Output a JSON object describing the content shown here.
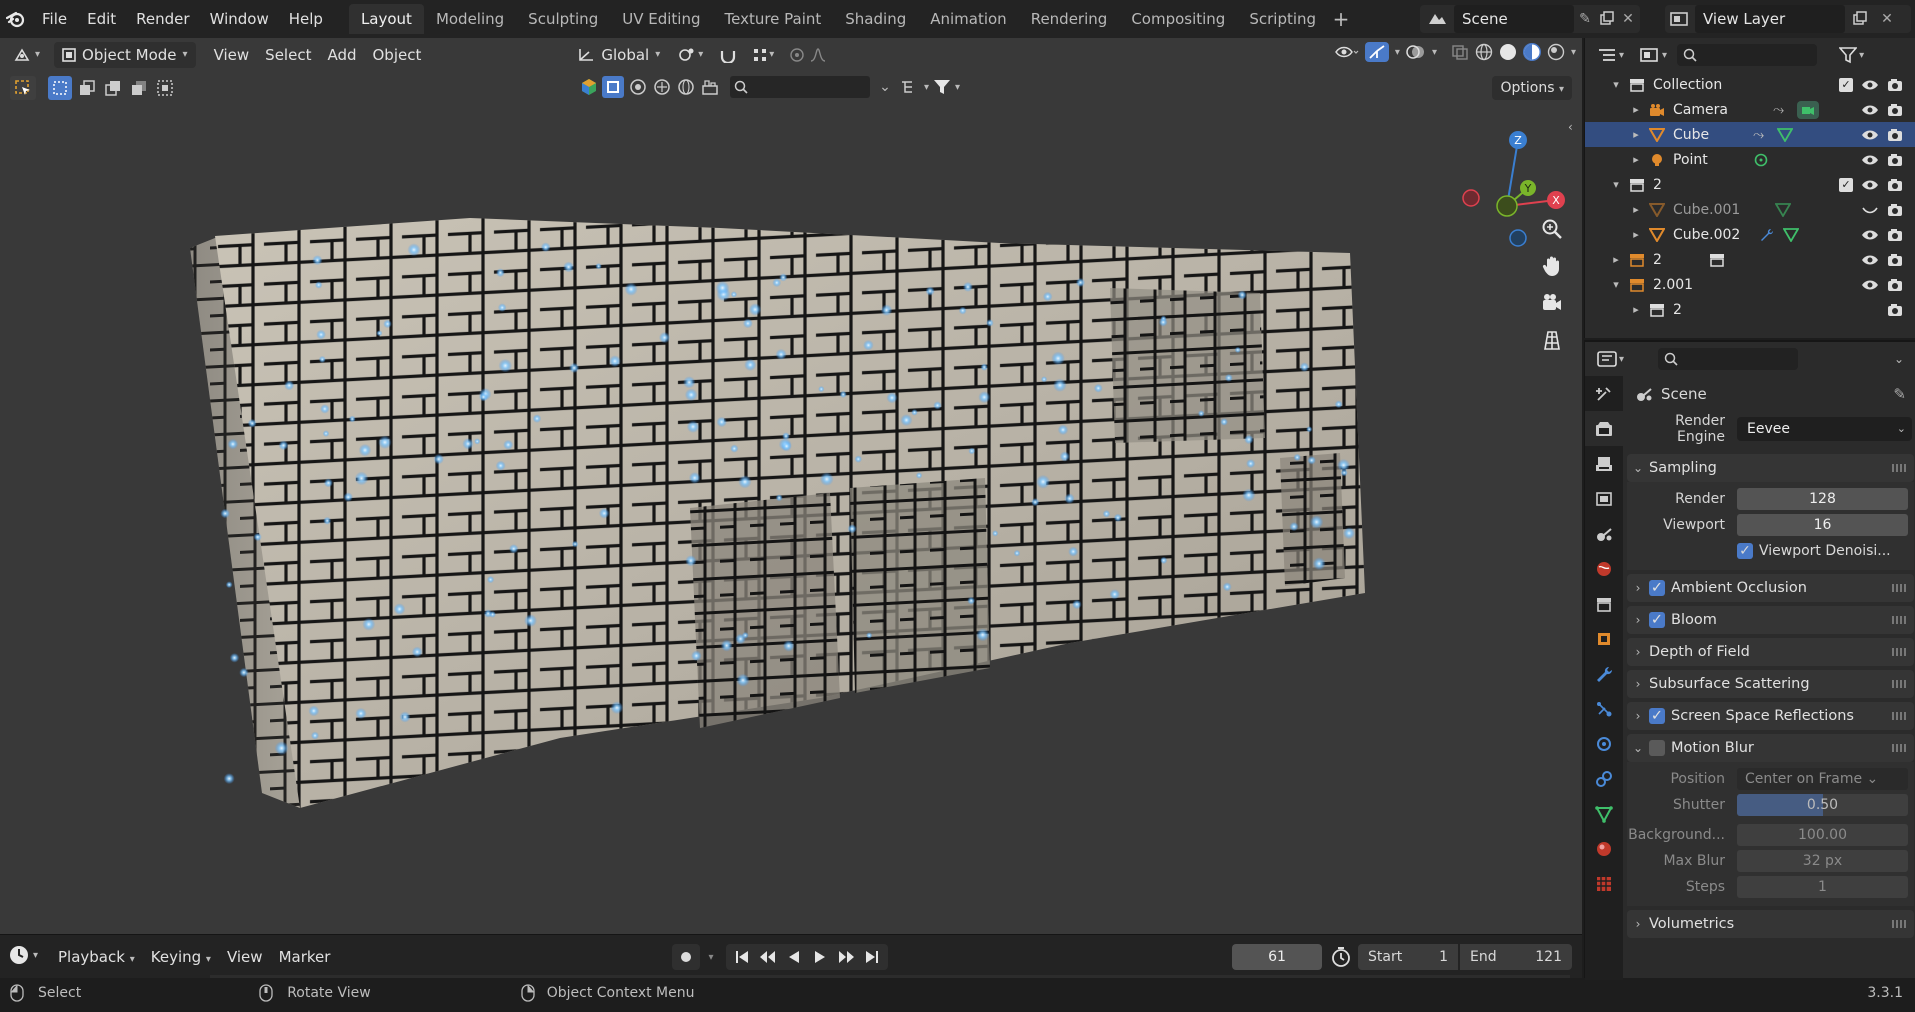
{
  "topbar": {
    "menus": [
      "File",
      "Edit",
      "Render",
      "Window",
      "Help"
    ],
    "workspaces": [
      "Layout",
      "Modeling",
      "Sculpting",
      "UV Editing",
      "Texture Paint",
      "Shading",
      "Animation",
      "Rendering",
      "Compositing",
      "Scripting"
    ],
    "active_workspace": "Layout",
    "scene": "Scene",
    "view_layer": "View Layer"
  },
  "viewport": {
    "mode": "Object Mode",
    "menus": [
      "View",
      "Select",
      "Add",
      "Object"
    ],
    "orientation": "Global",
    "options_label": "Options",
    "gizmo_axes": [
      "X",
      "Y",
      "Z"
    ]
  },
  "timeline": {
    "menus": [
      "Playback",
      "Keying",
      "View",
      "Marker"
    ],
    "current_frame": "61",
    "start_label": "Start",
    "start_value": "1",
    "end_label": "End",
    "end_value": "121"
  },
  "statusbar": {
    "select": "Select",
    "rotate": "Rotate View",
    "context": "Object Context Menu",
    "version": "3.3.1"
  },
  "outliner": {
    "rows": [
      {
        "label": "Collection",
        "type": "collection",
        "indent": 1,
        "expanded": true,
        "selected": false,
        "faded": false
      },
      {
        "label": "Camera",
        "type": "camera",
        "indent": 2,
        "expanded": false,
        "selected": false,
        "faded": false
      },
      {
        "label": "Cube",
        "type": "mesh",
        "indent": 2,
        "expanded": false,
        "selected": true,
        "faded": false
      },
      {
        "label": "Point",
        "type": "light",
        "indent": 2,
        "expanded": false,
        "selected": false,
        "faded": false
      },
      {
        "label": "2",
        "type": "collection",
        "indent": 1,
        "expanded": true,
        "selected": false,
        "faded": false
      },
      {
        "label": "Cube.001",
        "type": "mesh",
        "indent": 2,
        "expanded": false,
        "selected": false,
        "faded": true
      },
      {
        "label": "Cube.002",
        "type": "mesh",
        "indent": 2,
        "expanded": false,
        "selected": false,
        "faded": false
      },
      {
        "label": "2",
        "type": "collection-instance",
        "indent": 1,
        "expanded": false,
        "selected": false,
        "faded": false
      },
      {
        "label": "2.001",
        "type": "collection-instance",
        "indent": 1,
        "expanded": true,
        "selected": false,
        "faded": false
      },
      {
        "label": "2",
        "type": "collection",
        "indent": 2,
        "expanded": false,
        "selected": false,
        "faded": false
      }
    ]
  },
  "properties": {
    "context": "Scene",
    "render_engine_label": "Render Engine",
    "render_engine": "Eevee",
    "sampling": {
      "title": "Sampling",
      "render_label": "Render",
      "render": "128",
      "viewport_label": "Viewport",
      "viewport": "16",
      "denoise": "Viewport Denoisi..."
    },
    "panels": [
      {
        "label": "Ambient Occlusion",
        "checkbox": true
      },
      {
        "label": "Bloom",
        "checkbox": true
      },
      {
        "label": "Depth of Field",
        "checkbox": null
      },
      {
        "label": "Subsurface Scattering",
        "checkbox": null
      },
      {
        "label": "Screen Space Reflections",
        "checkbox": true
      }
    ],
    "motion_blur": {
      "title": "Motion Blur",
      "position_label": "Position",
      "position": "Center on Frame",
      "shutter_label": "Shutter",
      "shutter": "0.50",
      "shutter_fraction": 0.5,
      "background_label": "Background...",
      "background": "100.00",
      "maxblur_label": "Max Blur",
      "maxblur": "32 px",
      "steps_label": "Steps",
      "steps": "1"
    },
    "volumetrics": "Volumetrics"
  },
  "colors": {
    "accent": "#4a7ac8",
    "selection": "#334d80",
    "x_axis": "#e0414f",
    "y_axis": "#7ab52a",
    "z_axis": "#3a7fd1"
  }
}
